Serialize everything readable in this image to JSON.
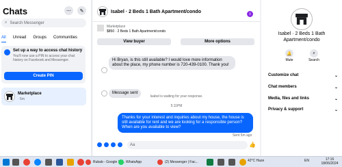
{
  "left": {
    "title": "Chats",
    "search_placeholder": "Search Messenger",
    "tabs": [
      {
        "label": "All",
        "active": true
      },
      {
        "label": "Unread",
        "active": false
      },
      {
        "label": "Groups",
        "active": false
      },
      {
        "label": "Communities",
        "active": false
      }
    ],
    "notice": {
      "title": "Set up a way to access chat history",
      "body": "You'll now use a PIN to access your chat history on Facebook and Messenger.",
      "button": "Create PIN"
    },
    "chat": {
      "name": "Marketplace",
      "sub": "· 5m"
    }
  },
  "conversation": {
    "title": "Isabel · 2 Beds 1 Bath Apartment/condo",
    "marketplace": {
      "label": "Marketplace",
      "price": "$850 · 2 Beds 1 Bath Apartment/condo",
      "view_buyer": "View buyer",
      "more_options": "More options"
    },
    "incoming_1": "Hi Bryan, is this still available? I would love more information about the place, my phone number is 720-439-0100. Thank you!",
    "incoming_2": "Message sent",
    "system_note": "Isabel is waiting for your response.",
    "time": "5:11PM",
    "outgoing": "Thanks for your interest and inquiries about my house, the house is still available for rent and we are looking for a responsible person? When are you available to view?",
    "sent_label": "Sent 5m ago",
    "composer_placeholder": "Aa"
  },
  "profile": {
    "name": "Isabel · 2 Beds 1 Bath Apartment/condo",
    "actions": [
      {
        "label": "Mute"
      },
      {
        "label": "Search"
      }
    ],
    "rows": [
      {
        "label": "Customize chat"
      },
      {
        "label": "Chat members"
      },
      {
        "label": "Media, files and links"
      },
      {
        "label": "Privacy & support"
      }
    ]
  },
  "taskbar": {
    "apps": [
      {
        "label": "Rubab - Google Sh...",
        "color": "#e94235"
      },
      {
        "label": "WhatsApp",
        "color": "#25d366"
      },
      {
        "label": "(2) Messenger | Fac...",
        "color": "#e94235"
      }
    ],
    "weather": "42°C Haze",
    "lang": "EN",
    "time": "17:16",
    "date": "18/06/2024"
  }
}
